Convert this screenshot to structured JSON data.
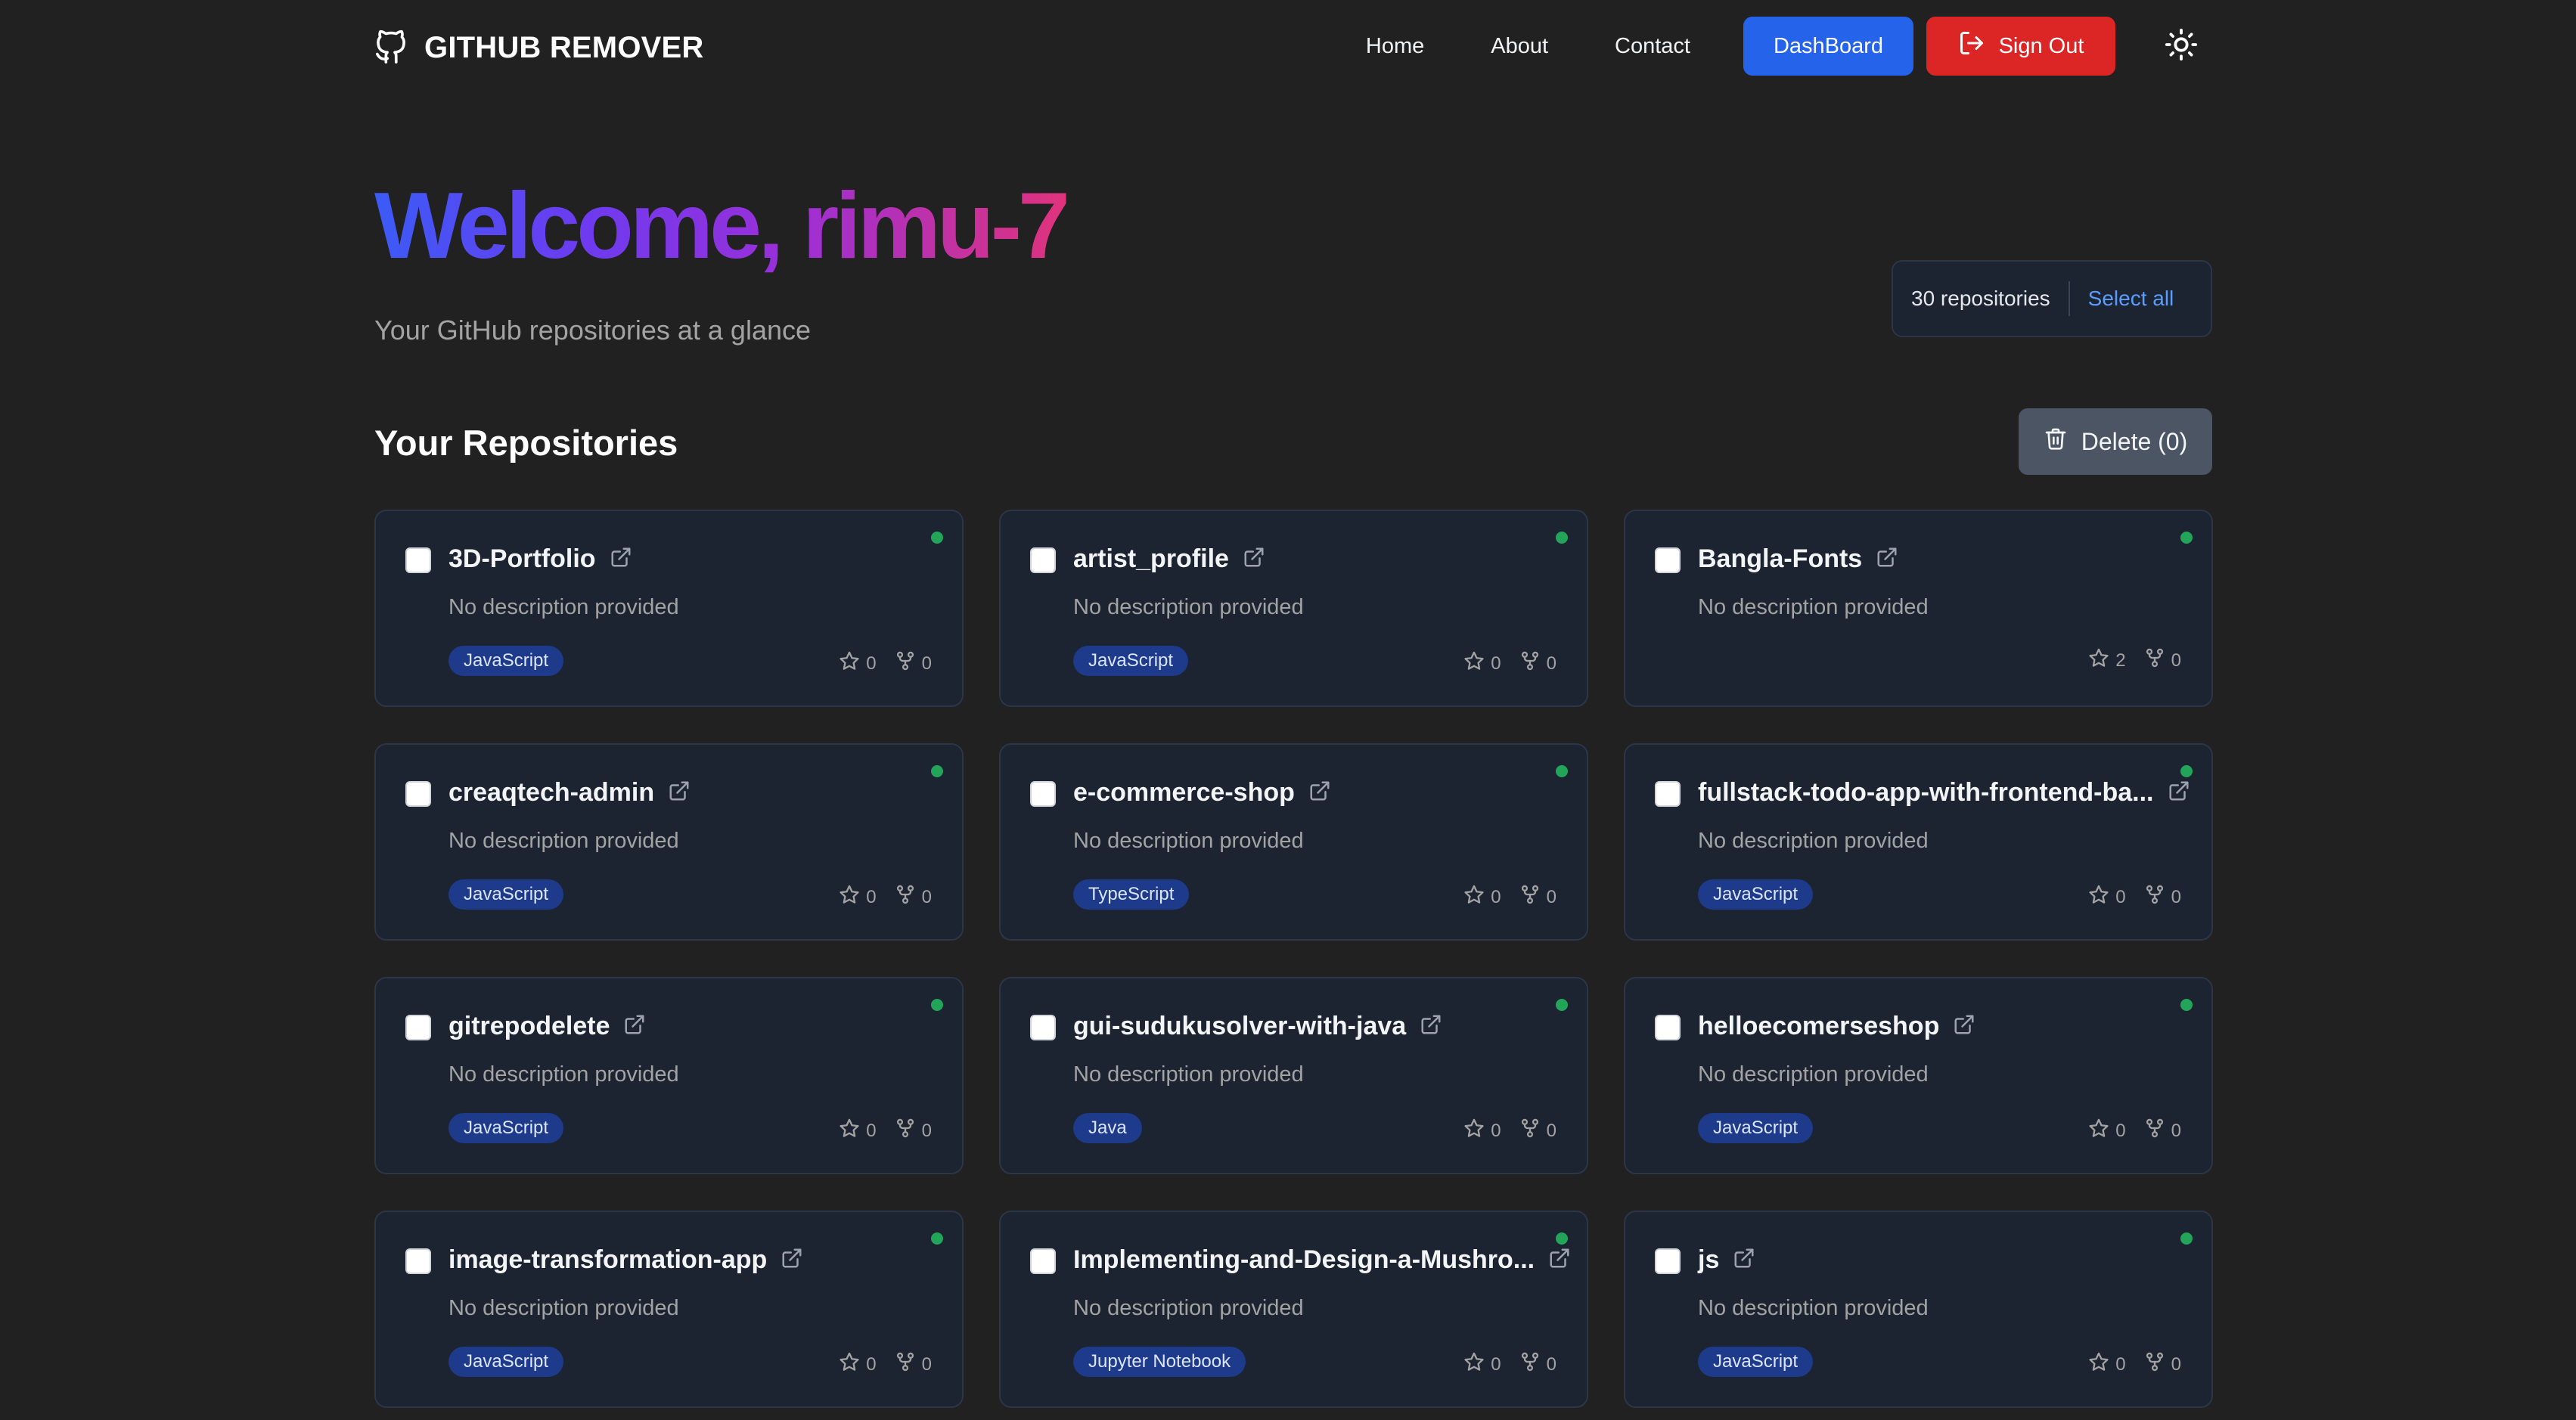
{
  "brand": {
    "name": "GITHUB REMOVER",
    "logo_icon": "github-icon"
  },
  "nav": {
    "links": [
      "Home",
      "About",
      "Contact"
    ],
    "dashboard_label": "DashBoard",
    "signout_label": "Sign Out",
    "theme_icon": "sun-icon"
  },
  "hero": {
    "welcome": "Welcome, rimu-7",
    "subtitle": "Your GitHub repositories at a glance",
    "repo_count": "30 repositories",
    "select_all": "Select all"
  },
  "section": {
    "title": "Your Repositories",
    "delete_label": "Delete (0)"
  },
  "colors": {
    "background": "#212121",
    "card": "#1c2331",
    "dashboard_button": "#2563eb",
    "signout_button": "#dc2626",
    "status_dot": "#22a559",
    "language_badge": "#1e3a8a",
    "link": "#5b9dff"
  },
  "repos": [
    {
      "name": "3D-Portfolio",
      "description": "No description provided",
      "language": "JavaScript",
      "stars": "0",
      "forks": "0"
    },
    {
      "name": "artist_profile",
      "description": "No description provided",
      "language": "JavaScript",
      "stars": "0",
      "forks": "0"
    },
    {
      "name": "Bangla-Fonts",
      "description": "No description provided",
      "language": "",
      "stars": "2",
      "forks": "0"
    },
    {
      "name": "creaqtech-admin",
      "description": "No description provided",
      "language": "JavaScript",
      "stars": "0",
      "forks": "0"
    },
    {
      "name": "e-commerce-shop",
      "description": "No description provided",
      "language": "TypeScript",
      "stars": "0",
      "forks": "0"
    },
    {
      "name": "fullstack-todo-app-with-frontend-ba...",
      "description": "No description provided",
      "language": "JavaScript",
      "stars": "0",
      "forks": "0"
    },
    {
      "name": "gitrepodelete",
      "description": "No description provided",
      "language": "JavaScript",
      "stars": "0",
      "forks": "0"
    },
    {
      "name": "gui-sudukusolver-with-java",
      "description": "No description provided",
      "language": "Java",
      "stars": "0",
      "forks": "0"
    },
    {
      "name": "helloecomerseshop",
      "description": "No description provided",
      "language": "JavaScript",
      "stars": "0",
      "forks": "0"
    },
    {
      "name": "image-transformation-app",
      "description": "No description provided",
      "language": "JavaScript",
      "stars": "0",
      "forks": "0"
    },
    {
      "name": "Implementing-and-Design-a-Mushro...",
      "description": "No description provided",
      "language": "Jupyter Notebook",
      "stars": "0",
      "forks": "0"
    },
    {
      "name": "js",
      "description": "No description provided",
      "language": "JavaScript",
      "stars": "0",
      "forks": "0"
    }
  ]
}
